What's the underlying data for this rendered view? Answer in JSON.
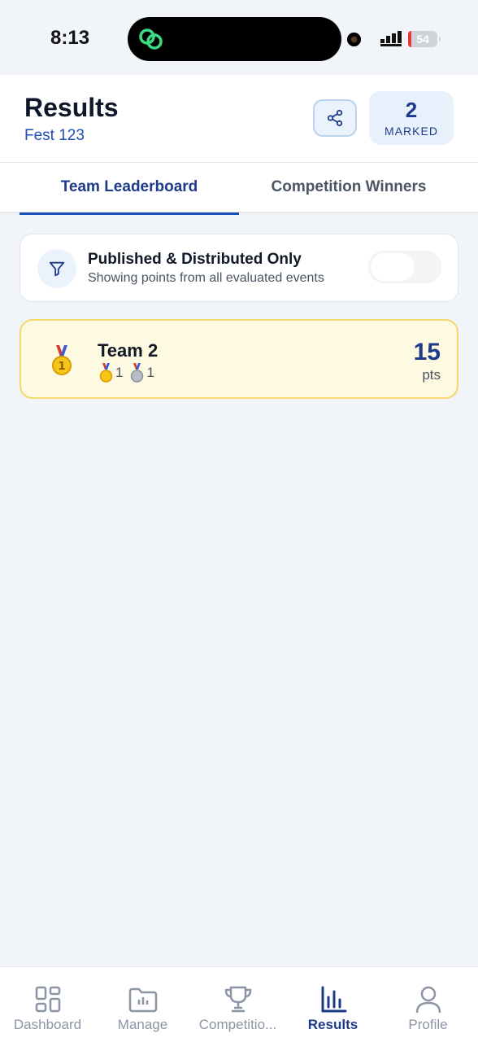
{
  "status_bar": {
    "time": "8:13",
    "battery": "54"
  },
  "header": {
    "title": "Results",
    "subtitle": "Fest 123",
    "marked_count": "2",
    "marked_label": "MARKED"
  },
  "tabs": [
    {
      "label": "Team Leaderboard",
      "active": true
    },
    {
      "label": "Competition Winners",
      "active": false
    }
  ],
  "filter": {
    "title": "Published & Distributed Only",
    "description": "Showing points from all evaluated events",
    "enabled": false
  },
  "leaderboard": [
    {
      "rank": 1,
      "team": "Team 2",
      "gold": "1",
      "silver": "1",
      "points": "15",
      "points_label": "pts"
    }
  ],
  "nav": [
    {
      "label": "Dashboard",
      "icon": "dashboard-icon"
    },
    {
      "label": "Manage",
      "icon": "folder-icon"
    },
    {
      "label": "Competitio...",
      "icon": "trophy-icon"
    },
    {
      "label": "Results",
      "icon": "bar-chart-icon",
      "active": true
    },
    {
      "label": "Profile",
      "icon": "user-icon"
    }
  ],
  "colors": {
    "accent": "#1e3a8a",
    "link": "#1e4fb4",
    "gold_card": "#fef9e1",
    "gold_border": "#f3d86a"
  }
}
